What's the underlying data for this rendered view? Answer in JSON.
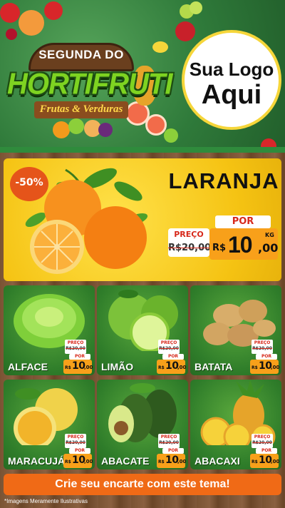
{
  "header": {
    "line1": "SEGUNDA DO",
    "brand": "HORTIFRUTI",
    "subtitle": "Frutas & Verduras"
  },
  "logo": {
    "line1": "Sua Logo",
    "line2": "Aqui"
  },
  "featured": {
    "name": "LARANJA",
    "discount": "-50%",
    "preco_label": "PREÇO",
    "old_price": "R$20,00",
    "por_label": "POR",
    "currency": "R$",
    "price_int": "10",
    "price_cents": ",00",
    "unit": "KG"
  },
  "products": [
    {
      "name": "ALFACE",
      "preco_label": "PREÇO",
      "old_price": "R$20,00",
      "por_label": "POR",
      "currency": "R$",
      "price_int": "10",
      "price_cents": ",00",
      "icon": "lettuce-icon"
    },
    {
      "name": "LIMÃO",
      "preco_label": "PREÇO",
      "old_price": "R$20,00",
      "por_label": "POR",
      "currency": "R$",
      "price_int": "10",
      "price_cents": ",00",
      "icon": "lime-icon"
    },
    {
      "name": "BATATA",
      "preco_label": "PREÇO",
      "old_price": "R$20,00",
      "por_label": "POR",
      "currency": "R$",
      "price_int": "10",
      "price_cents": ",00",
      "icon": "potato-icon"
    },
    {
      "name": "MARACUJÁ",
      "preco_label": "PREÇO",
      "old_price": "R$20,00",
      "por_label": "POR",
      "currency": "R$",
      "price_int": "10",
      "price_cents": ",00",
      "icon": "passion-fruit-icon"
    },
    {
      "name": "ABACATE",
      "preco_label": "PREÇO",
      "old_price": "R$20,00",
      "por_label": "POR",
      "currency": "R$",
      "price_int": "10",
      "price_cents": ",00",
      "icon": "avocado-icon"
    },
    {
      "name": "ABACAXI",
      "preco_label": "PREÇO",
      "old_price": "R$20,00",
      "por_label": "POR",
      "currency": "R$",
      "price_int": "10",
      "price_cents": ",00",
      "icon": "pineapple-icon"
    }
  ],
  "cta": {
    "label": "Crie seu encarte com este tema!"
  },
  "footnote": "*Imagens Meramente Ilustrativas",
  "colors": {
    "header_green": "#2f7a3a",
    "card_green": "#2f7d2a",
    "featured_yellow": "#f5c313",
    "price_orange": "#f8a01a",
    "cta_orange": "#f06a16",
    "discount_red": "#e5541a",
    "brand_green": "#7ed321"
  }
}
